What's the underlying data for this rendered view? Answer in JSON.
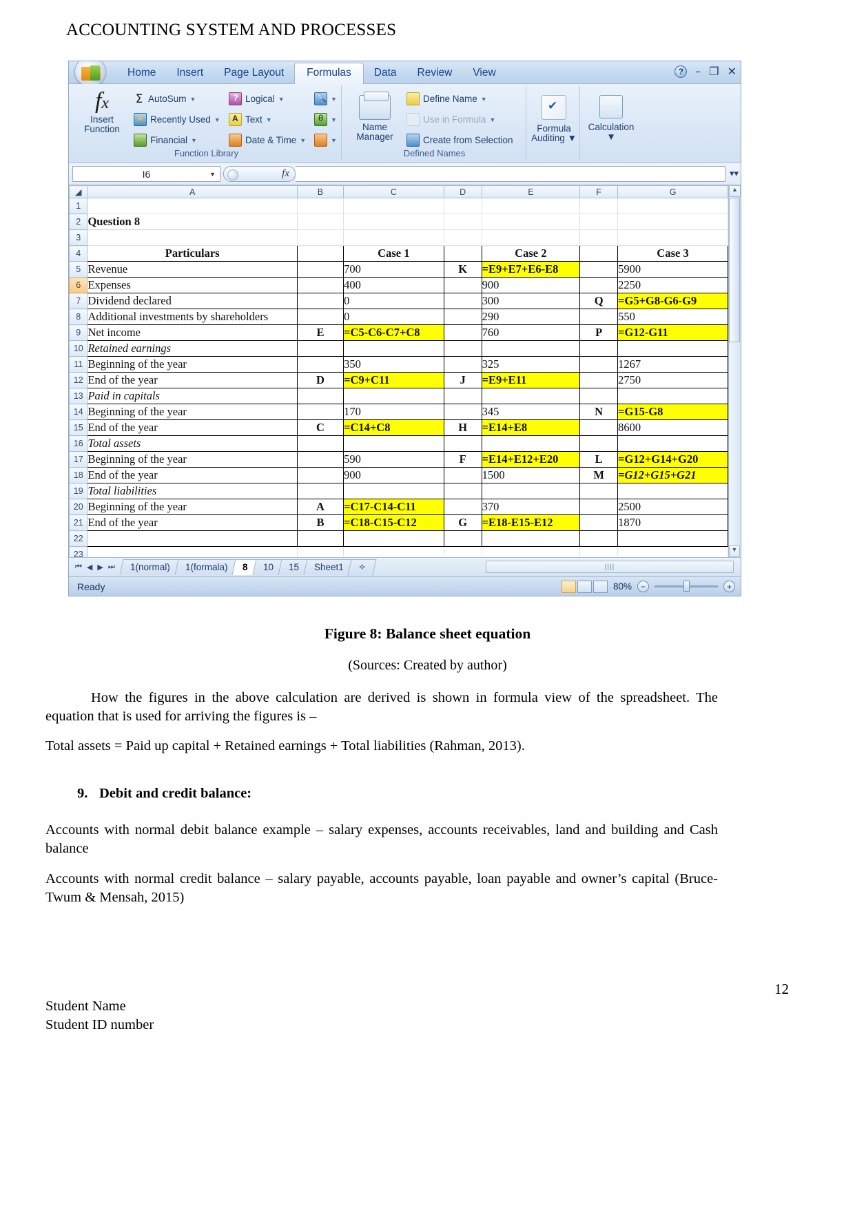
{
  "document": {
    "header": "ACCOUNTING SYSTEM AND PROCESSES",
    "figure_caption": "Figure 8: Balance sheet equation",
    "figure_source": "(Sources: Created by author)",
    "paragraph_1": "How the figures in the above calculation are derived is shown in formula view of the spreadsheet. The equation that is used for arriving the figures is –",
    "paragraph_2": "Total assets = Paid up capital + Retained earnings + Total liabilities (Rahman, 2013).",
    "heading_9_number": "9.",
    "heading_9_text": "Debit and credit balance:",
    "paragraph_3": "Accounts with normal debit balance example – salary expenses, accounts receivables, land and building and Cash balance",
    "paragraph_4": "Accounts with normal credit balance – salary payable, accounts payable, loan payable and owner’s capital (Bruce-Twum & Mensah, 2015)",
    "page_number": "12",
    "footer_name": "Student Name",
    "footer_id": "Student ID number"
  },
  "excel": {
    "ribbon_tabs": [
      {
        "label": "Home",
        "active": false
      },
      {
        "label": "Insert",
        "active": false
      },
      {
        "label": "Page Layout",
        "active": false
      },
      {
        "label": "Formulas",
        "active": true
      },
      {
        "label": "Data",
        "active": false
      },
      {
        "label": "Review",
        "active": false
      },
      {
        "label": "View",
        "active": false
      }
    ],
    "window_buttons": {
      "help": "?",
      "minimize": "–",
      "restore": "❐",
      "close": "✕"
    },
    "groups": {
      "function_library": {
        "label": "Function Library",
        "insert_function": {
          "line1": "Insert",
          "line2": "Function"
        },
        "items": [
          {
            "label": "AutoSum",
            "icon": "sigma-icon"
          },
          {
            "label": "Recently Used",
            "icon": "recently-used-icon"
          },
          {
            "label": "Financial",
            "icon": "financial-icon"
          },
          {
            "label": "Logical",
            "icon": "logical-icon"
          },
          {
            "label": "Text",
            "icon": "text-icon"
          },
          {
            "label": "Date & Time",
            "icon": "date-time-icon"
          }
        ]
      },
      "defined_names": {
        "label": "Defined Names",
        "name_manager": {
          "line1": "Name",
          "line2": "Manager"
        },
        "items": [
          {
            "label": "Define Name",
            "icon": "define-name-icon",
            "disabled": false
          },
          {
            "label": "Use in Formula",
            "icon": "use-in-formula-icon",
            "disabled": true
          },
          {
            "label": "Create from Selection",
            "icon": "create-from-selection-icon",
            "disabled": false
          }
        ]
      },
      "formula_auditing": {
        "line1": "Formula",
        "line2": "Auditing"
      },
      "calculation": {
        "line1": "Calculation",
        "line2": ""
      }
    },
    "formula_bar": {
      "name_box": "I6",
      "formula_value": "",
      "fx_label": "fx"
    },
    "columns": [
      "A",
      "B",
      "C",
      "D",
      "E",
      "F",
      "G"
    ],
    "row_numbers": [
      "1",
      "2",
      "3",
      "4",
      "5",
      "6",
      "7",
      "8",
      "9",
      "10",
      "11",
      "12",
      "13",
      "14",
      "15",
      "16",
      "17",
      "18",
      "19",
      "20",
      "21",
      "22",
      "23"
    ],
    "selected_row": "6",
    "rows": [
      {
        "n": "1",
        "cells": [
          {
            "v": "",
            "s": "blank"
          },
          {
            "v": "",
            "s": "blank"
          },
          {
            "v": "",
            "s": "blank"
          },
          {
            "v": "",
            "s": "blank"
          },
          {
            "v": "",
            "s": "blank"
          },
          {
            "v": "",
            "s": "blank"
          },
          {
            "v": "",
            "s": "blank"
          }
        ]
      },
      {
        "n": "2",
        "cells": [
          {
            "v": "Question 8",
            "s": "bold"
          },
          {
            "v": "",
            "s": "blank"
          },
          {
            "v": "",
            "s": "blank"
          },
          {
            "v": "",
            "s": "blank"
          },
          {
            "v": "",
            "s": "blank"
          },
          {
            "v": "",
            "s": "blank"
          },
          {
            "v": "",
            "s": "blank"
          }
        ]
      },
      {
        "n": "3",
        "cells": [
          {
            "v": "",
            "s": "blank"
          },
          {
            "v": "",
            "s": "blank"
          },
          {
            "v": "",
            "s": "blank"
          },
          {
            "v": "",
            "s": "blank"
          },
          {
            "v": "",
            "s": "blank"
          },
          {
            "v": "",
            "s": "blank"
          },
          {
            "v": "",
            "s": "blank"
          }
        ]
      },
      {
        "n": "4",
        "cells": [
          {
            "v": "Particulars",
            "s": "hdrrow"
          },
          {
            "v": "",
            "s": "bx"
          },
          {
            "v": "Case 1",
            "s": "hdrrow"
          },
          {
            "v": "",
            "s": "bx"
          },
          {
            "v": "Case 2",
            "s": "hdrrow"
          },
          {
            "v": "",
            "s": "bx"
          },
          {
            "v": "Case 3",
            "s": "hdrrow"
          }
        ]
      },
      {
        "n": "5",
        "cells": [
          {
            "v": "Revenue",
            "s": "bx"
          },
          {
            "v": "",
            "s": "bx"
          },
          {
            "v": "700",
            "s": "bx"
          },
          {
            "v": "K",
            "s": "ctr bx"
          },
          {
            "v": "=E9+E7+E6-E8",
            "s": "hl"
          },
          {
            "v": "",
            "s": "bx"
          },
          {
            "v": "5900",
            "s": "bx"
          }
        ]
      },
      {
        "n": "6",
        "cells": [
          {
            "v": "Expenses",
            "s": "bx"
          },
          {
            "v": "",
            "s": "bx"
          },
          {
            "v": "400",
            "s": "bx"
          },
          {
            "v": "",
            "s": "bx"
          },
          {
            "v": "900",
            "s": "bx"
          },
          {
            "v": "",
            "s": "bx"
          },
          {
            "v": "2250",
            "s": "bx"
          }
        ]
      },
      {
        "n": "7",
        "cells": [
          {
            "v": "Dividend declared",
            "s": "bx"
          },
          {
            "v": "",
            "s": "bx"
          },
          {
            "v": "0",
            "s": "bx"
          },
          {
            "v": "",
            "s": "bx"
          },
          {
            "v": "300",
            "s": "bx"
          },
          {
            "v": "Q",
            "s": "ctr bx"
          },
          {
            "v": "=G5+G8-G6-G9",
            "s": "hl"
          }
        ]
      },
      {
        "n": "8",
        "cells": [
          {
            "v": "Additional investments by shareholders",
            "s": "bx"
          },
          {
            "v": "",
            "s": "bx"
          },
          {
            "v": "0",
            "s": "bx"
          },
          {
            "v": "",
            "s": "bx"
          },
          {
            "v": "290",
            "s": "bx"
          },
          {
            "v": "",
            "s": "bx"
          },
          {
            "v": "550",
            "s": "bx"
          }
        ]
      },
      {
        "n": "9",
        "cells": [
          {
            "v": "Net income",
            "s": "bx"
          },
          {
            "v": "E",
            "s": "ctr bx"
          },
          {
            "v": "=C5-C6-C7+C8",
            "s": "hl"
          },
          {
            "v": "",
            "s": "bx"
          },
          {
            "v": "760",
            "s": "bx"
          },
          {
            "v": "P",
            "s": "ctr bx"
          },
          {
            "v": "=G12-G11",
            "s": "hl"
          }
        ]
      },
      {
        "n": "10",
        "cells": [
          {
            "v": "Retained earnings",
            "s": "ital bx"
          },
          {
            "v": "",
            "s": "bx"
          },
          {
            "v": "",
            "s": "bx"
          },
          {
            "v": "",
            "s": "bx"
          },
          {
            "v": "",
            "s": "bx"
          },
          {
            "v": "",
            "s": "bx"
          },
          {
            "v": "",
            "s": "bx"
          }
        ]
      },
      {
        "n": "11",
        "cells": [
          {
            "v": "Beginning of the year",
            "s": "bx"
          },
          {
            "v": "",
            "s": "bx"
          },
          {
            "v": "350",
            "s": "bx"
          },
          {
            "v": "",
            "s": "bx"
          },
          {
            "v": "325",
            "s": "bx"
          },
          {
            "v": "",
            "s": "bx"
          },
          {
            "v": "1267",
            "s": "bx"
          }
        ]
      },
      {
        "n": "12",
        "cells": [
          {
            "v": "End of the year",
            "s": "bx"
          },
          {
            "v": "D",
            "s": "ctr bx"
          },
          {
            "v": "=C9+C11",
            "s": "hl"
          },
          {
            "v": "J",
            "s": "ctr bx"
          },
          {
            "v": "=E9+E11",
            "s": "hl"
          },
          {
            "v": "",
            "s": "bx"
          },
          {
            "v": "2750",
            "s": "bx"
          }
        ]
      },
      {
        "n": "13",
        "cells": [
          {
            "v": "Paid in capitals",
            "s": "ital bx"
          },
          {
            "v": "",
            "s": "bx"
          },
          {
            "v": "",
            "s": "bx"
          },
          {
            "v": "",
            "s": "bx"
          },
          {
            "v": "",
            "s": "bx"
          },
          {
            "v": "",
            "s": "bx"
          },
          {
            "v": "",
            "s": "bx"
          }
        ]
      },
      {
        "n": "14",
        "cells": [
          {
            "v": "Beginning of the year",
            "s": "bx"
          },
          {
            "v": "",
            "s": "bx"
          },
          {
            "v": "170",
            "s": "bx"
          },
          {
            "v": "",
            "s": "bx"
          },
          {
            "v": "345",
            "s": "bx"
          },
          {
            "v": "N",
            "s": "ctr bx"
          },
          {
            "v": "=G15-G8",
            "s": "hl"
          }
        ]
      },
      {
        "n": "15",
        "cells": [
          {
            "v": "End of the year",
            "s": "bx"
          },
          {
            "v": "C",
            "s": "ctr bx"
          },
          {
            "v": "=C14+C8",
            "s": "hl"
          },
          {
            "v": "H",
            "s": "ctr bx"
          },
          {
            "v": "=E14+E8",
            "s": "hl"
          },
          {
            "v": "",
            "s": "bx"
          },
          {
            "v": "8600",
            "s": "bx"
          }
        ]
      },
      {
        "n": "16",
        "cells": [
          {
            "v": "Total assets",
            "s": "ital bx"
          },
          {
            "v": "",
            "s": "bx"
          },
          {
            "v": "",
            "s": "bx"
          },
          {
            "v": "",
            "s": "bx"
          },
          {
            "v": "",
            "s": "bx"
          },
          {
            "v": "",
            "s": "bx"
          },
          {
            "v": "",
            "s": "bx"
          }
        ]
      },
      {
        "n": "17",
        "cells": [
          {
            "v": "Beginning of the year",
            "s": "bx"
          },
          {
            "v": "",
            "s": "bx"
          },
          {
            "v": "590",
            "s": "bx"
          },
          {
            "v": "F",
            "s": "ctr bx"
          },
          {
            "v": "=E14+E12+E20",
            "s": "hl"
          },
          {
            "v": "L",
            "s": "ctr bx"
          },
          {
            "v": "=G12+G14+G20",
            "s": "hl"
          }
        ]
      },
      {
        "n": "18",
        "cells": [
          {
            "v": "End of the year",
            "s": "bx"
          },
          {
            "v": "",
            "s": "bx"
          },
          {
            "v": "900",
            "s": "bx"
          },
          {
            "v": "",
            "s": "bx"
          },
          {
            "v": "1500",
            "s": "bx"
          },
          {
            "v": "M",
            "s": "ctr bx"
          },
          {
            "v": "=G12+G15+G21",
            "s": "ital-bold-hl"
          }
        ]
      },
      {
        "n": "19",
        "cells": [
          {
            "v": "Total liabilities",
            "s": "ital bx"
          },
          {
            "v": "",
            "s": "bx"
          },
          {
            "v": "",
            "s": "bx"
          },
          {
            "v": "",
            "s": "bx"
          },
          {
            "v": "",
            "s": "bx"
          },
          {
            "v": "",
            "s": "bx"
          },
          {
            "v": "",
            "s": "bx"
          }
        ]
      },
      {
        "n": "20",
        "cells": [
          {
            "v": "Beginning of the year",
            "s": "bx"
          },
          {
            "v": "A",
            "s": "ctr bx"
          },
          {
            "v": "=C17-C14-C11",
            "s": "hl"
          },
          {
            "v": "",
            "s": "bx"
          },
          {
            "v": "370",
            "s": "bx"
          },
          {
            "v": "",
            "s": "bx"
          },
          {
            "v": "2500",
            "s": "bx"
          }
        ]
      },
      {
        "n": "21",
        "cells": [
          {
            "v": "End of the year",
            "s": "bx"
          },
          {
            "v": "B",
            "s": "ctr bx"
          },
          {
            "v": "=C18-C15-C12",
            "s": "hl"
          },
          {
            "v": "G",
            "s": "ctr bx"
          },
          {
            "v": "=E18-E15-E12",
            "s": "hl"
          },
          {
            "v": "",
            "s": "bx"
          },
          {
            "v": "1870",
            "s": "bx"
          }
        ]
      },
      {
        "n": "22",
        "cells": [
          {
            "v": "",
            "s": "bx"
          },
          {
            "v": "",
            "s": "bx"
          },
          {
            "v": "",
            "s": "bx"
          },
          {
            "v": "",
            "s": "bx"
          },
          {
            "v": "",
            "s": "bx"
          },
          {
            "v": "",
            "s": "bx"
          },
          {
            "v": "",
            "s": "bx"
          }
        ]
      },
      {
        "n": "23",
        "cells": [
          {
            "v": "",
            "s": "blank"
          },
          {
            "v": "",
            "s": "blank"
          },
          {
            "v": "",
            "s": "blank"
          },
          {
            "v": "",
            "s": "blank"
          },
          {
            "v": "",
            "s": "blank"
          },
          {
            "v": "",
            "s": "blank"
          },
          {
            "v": "",
            "s": "blank"
          }
        ]
      }
    ],
    "sheet_tabs": [
      {
        "label": "1(normal)",
        "active": false
      },
      {
        "label": "1(formala)",
        "active": false
      },
      {
        "label": "8",
        "active": true
      },
      {
        "label": "10",
        "active": false
      },
      {
        "label": "15",
        "active": false
      },
      {
        "label": "Sheet1",
        "active": false
      }
    ],
    "status": {
      "text": "Ready",
      "zoom": "80%"
    },
    "colors": {
      "highlight": "#ffff00",
      "selected_header": "#f7c98b",
      "ribbon_text": "#1c3f6e"
    }
  }
}
